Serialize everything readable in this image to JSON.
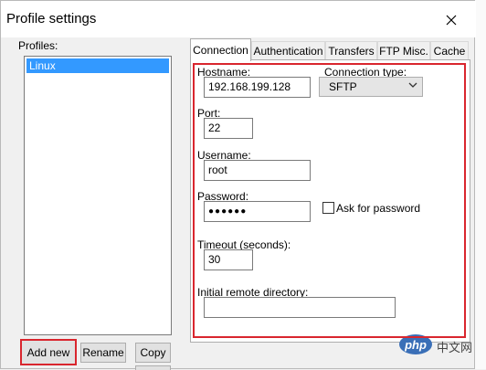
{
  "dialog": {
    "title": "Profile settings",
    "profiles_label": "Profiles:",
    "profiles": [
      {
        "name": "Linux",
        "selected": true
      }
    ],
    "buttons": {
      "add_new": "Add new",
      "rename": "Rename",
      "copy": "Copy"
    }
  },
  "tabs": [
    {
      "label": "Connection",
      "active": true
    },
    {
      "label": "Authentication",
      "active": false
    },
    {
      "label": "Transfers",
      "active": false
    },
    {
      "label": "FTP Misc.",
      "active": false
    },
    {
      "label": "Cache",
      "active": false
    }
  ],
  "connection": {
    "hostname_label": "Hostname:",
    "hostname_value": "192.168.199.128",
    "connection_type_label": "Connection type:",
    "connection_type_value": "SFTP",
    "port_label": "Port:",
    "port_value": "22",
    "username_label": "Username:",
    "username_value": "root",
    "password_label": "Password:",
    "password_value": "●●●●●●",
    "ask_password_label": "Ask for password",
    "ask_password_checked": false,
    "timeout_label": "Timeout (seconds):",
    "timeout_value": "30",
    "remote_dir_label": "Initial remote directory:",
    "remote_dir_value": ""
  },
  "watermark": {
    "logo_text": "php",
    "text": "中文网"
  },
  "colors": {
    "highlight_red": "#d9262e",
    "selection_blue": "#3399ff",
    "watermark_blue": "#3a6fb7"
  }
}
